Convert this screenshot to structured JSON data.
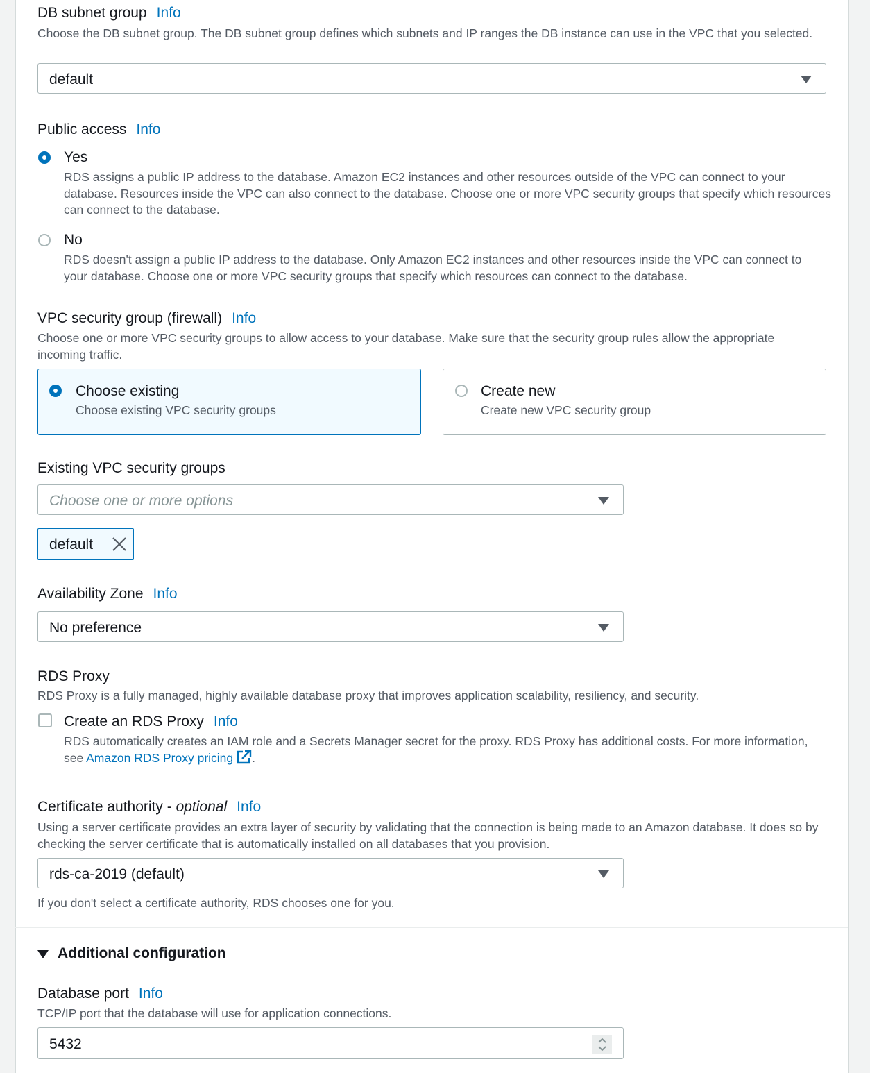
{
  "db_subnet_group": {
    "label": "DB subnet group",
    "info": "Info",
    "description": "Choose the DB subnet group. The DB subnet group defines which subnets and IP ranges the DB instance can use in the VPC that you selected.",
    "value": "default"
  },
  "public_access": {
    "label": "Public access",
    "info": "Info",
    "selected": "Yes",
    "options": [
      {
        "label": "Yes",
        "description": "RDS assigns a public IP address to the database. Amazon EC2 instances and other resources outside of the VPC can connect to your database. Resources inside the VPC can also connect to the database. Choose one or more VPC security groups that specify which resources can connect to the database.",
        "checked": true
      },
      {
        "label": "No",
        "description": "RDS doesn't assign a public IP address to the database. Only Amazon EC2 instances and other resources inside the VPC can connect to your database. Choose one or more VPC security groups that specify which resources can connect to the database.",
        "checked": false
      }
    ]
  },
  "vpc_security_group": {
    "label": "VPC security group (firewall)",
    "info": "Info",
    "description": "Choose one or more VPC security groups to allow access to your database. Make sure that the security group rules allow the appropriate incoming traffic.",
    "tiles": [
      {
        "title": "Choose existing",
        "description": "Choose existing VPC security groups",
        "checked": true
      },
      {
        "title": "Create new",
        "description": "Create new VPC security group",
        "checked": false
      }
    ]
  },
  "existing_vpc_security_groups": {
    "label": "Existing VPC security groups",
    "placeholder": "Choose one or more options",
    "tokens": [
      {
        "label": "default"
      }
    ]
  },
  "availability_zone": {
    "label": "Availability Zone",
    "info": "Info",
    "value": "No preference"
  },
  "rds_proxy": {
    "label": "RDS Proxy",
    "description": "RDS Proxy is a fully managed, highly available database proxy that improves application scalability, resiliency, and security.",
    "checkbox_label": "Create an RDS Proxy",
    "checked": false,
    "info": "Info",
    "checkbox_description": "RDS automatically creates an IAM role and a Secrets Manager secret for the proxy. RDS Proxy has additional costs. For more information, see ",
    "link_text": "Amazon RDS Proxy pricing",
    "trailing": "."
  },
  "certificate_authority": {
    "label": "Certificate authority - ",
    "label_optional": "optional",
    "info": "Info",
    "description": "Using a server certificate provides an extra layer of security by validating that the connection is being made to an Amazon database. It does so by checking the server certificate that is automatically installed on all databases that you provision.",
    "value": "rds-ca-2019 (default)",
    "hint": "If you don't select a certificate authority, RDS chooses one for you."
  },
  "additional_configuration": {
    "title": "Additional configuration",
    "expanded": true
  },
  "database_port": {
    "label": "Database port",
    "info": "Info",
    "description": "TCP/IP port that the database will use for application connections.",
    "value": "5432"
  },
  "colors": {
    "accent": "#0073bb",
    "text": "#16191f",
    "secondary_text": "#545b64",
    "border": "#aab7b8",
    "selected_tile_bg": "#f1faff",
    "page_bg": "#f2f3f3"
  }
}
